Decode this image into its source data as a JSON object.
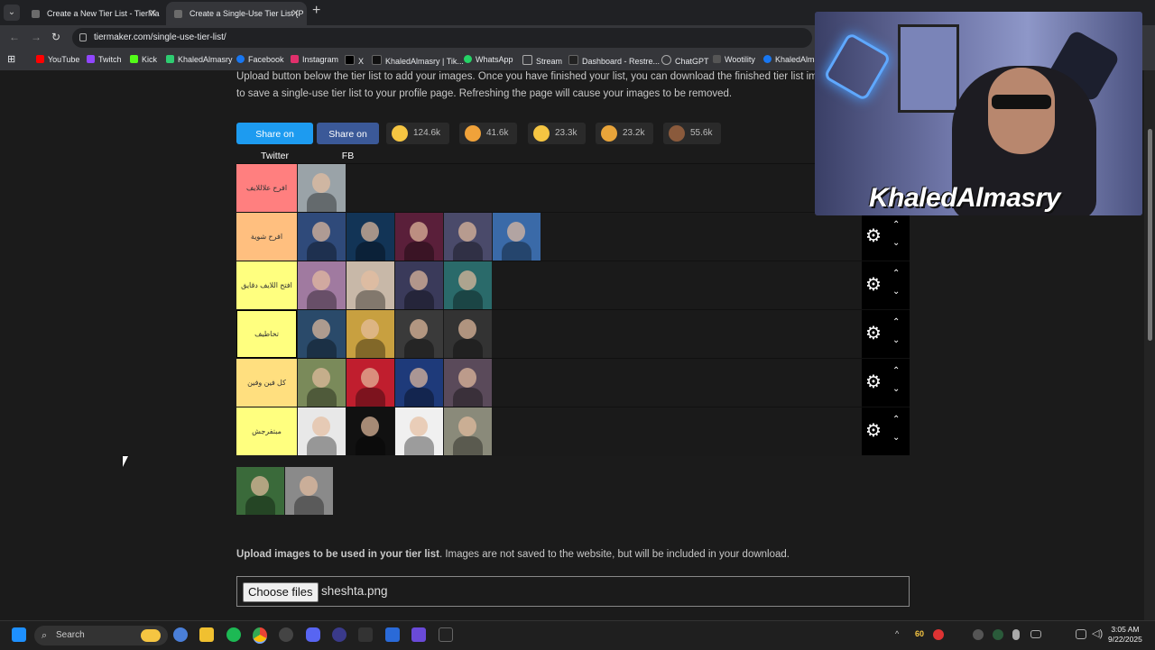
{
  "browser": {
    "tabs": [
      {
        "title": "Create a New Tier List - TierMa",
        "active": false
      },
      {
        "title": "Create a Single-Use Tier List (P",
        "active": true
      }
    ],
    "url": "tiermaker.com/single-use-tier-list/",
    "bookmarks": [
      {
        "label": "YouTube",
        "color": "#ff0000"
      },
      {
        "label": "Twitch",
        "color": "#9146ff"
      },
      {
        "label": "Kick",
        "color": "#53fc18"
      },
      {
        "label": "KhaledAlmasry",
        "color": "#2ecc71"
      },
      {
        "label": "Facebook",
        "color": "#1877f2"
      },
      {
        "label": "Instagram",
        "color": "#e1306c"
      },
      {
        "label": "X",
        "color": "#000000"
      },
      {
        "label": "KhaledAlmasry | Tik...",
        "color": "#111111"
      },
      {
        "label": "WhatsApp",
        "color": "#25d366"
      },
      {
        "label": "Stream",
        "color": "#777777"
      },
      {
        "label": "Dashboard - Restre...",
        "color": "#222222"
      },
      {
        "label": "ChatGPT",
        "color": "#777777"
      },
      {
        "label": "Wootility",
        "color": "#555555"
      },
      {
        "label": "KhaledAlma",
        "color": "#1877f2"
      }
    ]
  },
  "intro": {
    "line1": "Upload button below the tier list to add your images. Once you have finished your list, you can download the finished tier list ima",
    "line2": "to save a single-use tier list to your profile page. Refreshing the page will cause your images to be removed."
  },
  "share": {
    "twitter": "Share on Twitter",
    "fb": "Share on FB",
    "twitter_color": "#1d9bf0",
    "fb_color": "#3b5998"
  },
  "reactions": [
    {
      "count": "124.6k",
      "icon": "grin-emoji",
      "color": "#f5c542"
    },
    {
      "count": "41.6k",
      "icon": "heart-eyes-emoji",
      "color": "#f0a23a"
    },
    {
      "count": "23.3k",
      "icon": "laughing-emoji",
      "color": "#f5c542"
    },
    {
      "count": "23.2k",
      "icon": "raised-hands-emoji",
      "color": "#e8a43a"
    },
    {
      "count": "55.6k",
      "icon": "poop-emoji",
      "color": "#8a5a3c"
    }
  ],
  "tiers": [
    {
      "label": "افرح علاللايف",
      "color": "#ff7f7f",
      "images": [
        "#9aa3a8"
      ],
      "controls": false
    },
    {
      "label": "افرح شوية",
      "color": "#ffbf7f",
      "images": [
        "#2f4a7a",
        "#123456",
        "#5a1f3a",
        "#4a4a6a",
        "#3a6aa8"
      ],
      "controls": true
    },
    {
      "label": "افتح اللايف دقايق",
      "color": "#ffff7f",
      "images": [
        "#a07aa0",
        "#c8b8a8",
        "#3a3a5a",
        "#2a6a6a"
      ],
      "controls": true
    },
    {
      "label": "تخاطيف",
      "color": "#ffff7f",
      "images": [
        "#2a4a6a",
        "#c8a040",
        "#3a3a3a",
        "#333333"
      ],
      "controls": true,
      "selected": true
    },
    {
      "label": "كل فين وفين",
      "color": "#ffdf7f",
      "images": [
        "#7a8a5a",
        "#c01e2e",
        "#1e3a7a",
        "#5a4a5a"
      ],
      "controls": true
    },
    {
      "label": "مبتفرجش",
      "color": "#ffff7f",
      "images": [
        "#e8e8e8",
        "#111111",
        "#f0f0f0",
        "#8a8a7a"
      ],
      "controls": true
    }
  ],
  "pool": [
    "#3a6a3a",
    "#8a8a8a"
  ],
  "upload": {
    "bold": "Upload images to be used in your tier list",
    "rest": ". Images are not saved to the website, but will be included in your download.",
    "button": "Choose files",
    "filename": "sheshta.png"
  },
  "webcam": {
    "name": "KhaledAlmasry"
  },
  "taskbar": {
    "search": "Search",
    "tray_number": "60",
    "time": "3:05 AM",
    "date": "9/22/2025"
  }
}
